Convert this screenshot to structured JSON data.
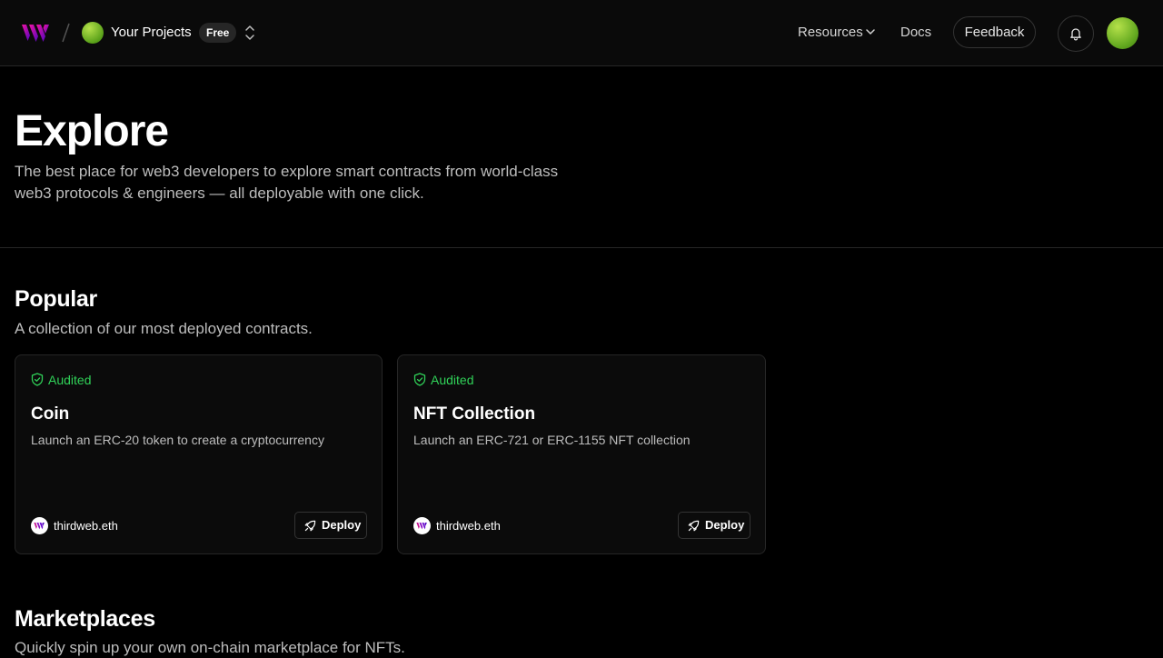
{
  "header": {
    "project_name": "Your Projects",
    "plan_badge": "Free",
    "nav": {
      "resources": "Resources",
      "docs": "Docs",
      "feedback": "Feedback"
    },
    "icons": [
      "thirdweb-logo-icon",
      "slash-icon",
      "project-avatar",
      "chevron-up-down-icon",
      "chevron-down-icon",
      "bell-icon",
      "user-avatar"
    ]
  },
  "hero": {
    "title": "Explore",
    "subtitle": "The best place for web3 developers to explore smart contracts from world-class web3 protocols & engineers — all deployable with one click."
  },
  "popular": {
    "title": "Popular",
    "subtitle": "A collection of our most deployed contracts.",
    "cards": [
      {
        "badge": "Audited",
        "title": "Coin",
        "description": "Launch an ERC-20 token to create a cryptocurrency",
        "author": "thirdweb.eth",
        "action": "Deploy"
      },
      {
        "badge": "Audited",
        "title": "NFT Collection",
        "description": "Launch an ERC-721 or ERC-1155 NFT collection",
        "author": "thirdweb.eth",
        "action": "Deploy"
      }
    ]
  },
  "marketplaces": {
    "title": "Marketplaces",
    "subtitle": "Quickly spin up your own on-chain marketplace for NFTs."
  },
  "colors": {
    "background": "#000000",
    "topbar": "#0a0a0a",
    "card": "#0b0b0b",
    "border": "#262626",
    "audited_green": "#30d158",
    "logo_gradient": [
      "#f213a4",
      "#5204bf"
    ],
    "avatar_green": "#7cc52a"
  }
}
